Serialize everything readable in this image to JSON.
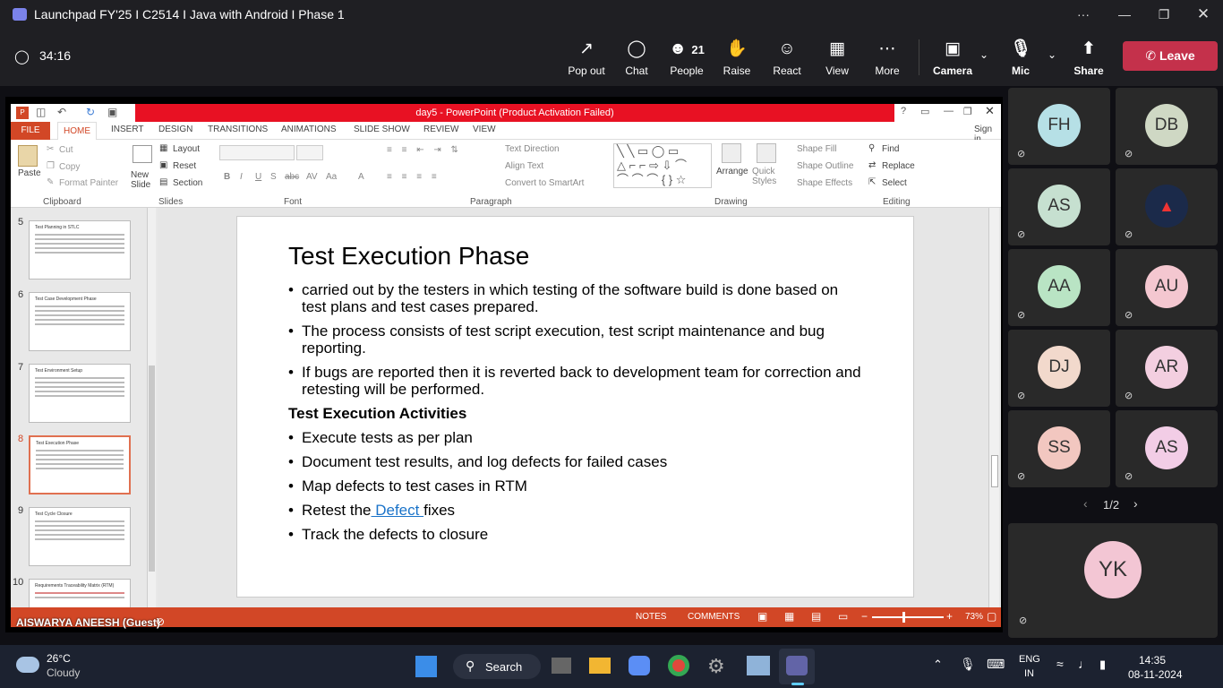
{
  "window": {
    "title": "Launchpad FY'25 I C2514 I Java with Android I Phase 1",
    "more": "···"
  },
  "meeting": {
    "timer": "34:16",
    "toolbar": [
      {
        "label": "Pop out"
      },
      {
        "label": "Chat"
      },
      {
        "label": "People",
        "count": "21"
      },
      {
        "label": "Raise"
      },
      {
        "label": "React"
      },
      {
        "label": "View"
      },
      {
        "label": "More"
      },
      {
        "label": "Camera"
      },
      {
        "label": "Mic"
      },
      {
        "label": "Share"
      }
    ],
    "leave": "Leave",
    "presenter": "AISWARYA ANEESH (Guest)"
  },
  "ppt": {
    "title": "day5 - PowerPoint (Product Activation Failed)",
    "help": "?",
    "signin": "Sign in",
    "tabs": [
      "FILE",
      "HOME",
      "INSERT",
      "DESIGN",
      "TRANSITIONS",
      "ANIMATIONS",
      "SLIDE SHOW",
      "REVIEW",
      "VIEW"
    ],
    "ribbon": {
      "clipboard": {
        "paste": "Paste",
        "cut": "Cut",
        "copy": "Copy",
        "format_painter": "Format Painter",
        "group": "Clipboard"
      },
      "slides": {
        "new_slide": "New Slide",
        "layout": "Layout",
        "reset": "Reset",
        "section": "Section",
        "group": "Slides"
      },
      "font": {
        "group": "Font",
        "bold": "B",
        "italic": "I",
        "underline": "U",
        "strike": "S",
        "abc": "abc",
        "spacing": "AV",
        "case": "Aa",
        "color": "A"
      },
      "paragraph": {
        "group": "Paragraph",
        "text_direction": "Text Direction",
        "align_text": "Align Text",
        "convert": "Convert to SmartArt"
      },
      "drawing": {
        "group": "Drawing",
        "arrange": "Arrange",
        "quick_styles": "Quick Styles",
        "shape_fill": "Shape Fill",
        "shape_outline": "Shape Outline",
        "shape_effects": "Shape Effects"
      },
      "editing": {
        "group": "Editing",
        "find": "Find",
        "replace": "Replace",
        "select": "Select"
      }
    },
    "thumbnails": [
      {
        "num": "5",
        "title": "Test Planning in STLC"
      },
      {
        "num": "6",
        "title": "Test Case Development Phase"
      },
      {
        "num": "7",
        "title": "Test Environment Setup"
      },
      {
        "num": "8",
        "title": "Test Execution Phase"
      },
      {
        "num": "9",
        "title": "Test Cycle Closure"
      },
      {
        "num": "10",
        "title": "Requirements Traceability Matrix (RTM)"
      }
    ],
    "slide": {
      "heading": "Test Execution Phase",
      "bullets": [
        "carried out by the testers in which testing of the software build is done based on test plans and test cases prepared.",
        "The process consists of test script execution, test script maintenance and bug reporting.",
        "If bugs are reported then it is reverted back to development team for correction and retesting will be performed."
      ],
      "subheading": "Test Execution Activities",
      "activities": [
        "Execute tests as per plan",
        "Document test results, and log defects for failed cases",
        "Map defects to test cases in RTM"
      ],
      "retest_pre": "Retest the",
      "retest_link": " Defect ",
      "retest_post": "fixes",
      "last": "Track the defects to closure"
    },
    "status": {
      "notes": "NOTES",
      "comments": "COMMENTS",
      "zoom": "73%"
    }
  },
  "participants": {
    "tiles": [
      {
        "initials": "FH",
        "color": "#b6e0e6"
      },
      {
        "initials": "DB",
        "color": "#cfd8c4"
      },
      {
        "initials": "AS",
        "color": "#c6e0d0"
      },
      {
        "initials": "",
        "color": "#1b2a4a"
      },
      {
        "initials": "AA",
        "color": "#b9e4c4"
      },
      {
        "initials": "AU",
        "color": "#f4c7d0"
      },
      {
        "initials": "DJ",
        "color": "#f2d9cc"
      },
      {
        "initials": "AR",
        "color": "#f3cfe0"
      },
      {
        "initials": "SS",
        "color": "#f2c7c0"
      },
      {
        "initials": "AS",
        "color": "#f2cde6"
      }
    ],
    "pager": "1/2",
    "self": {
      "initials": "YK",
      "color": "#f3c6d4"
    }
  },
  "taskbar": {
    "weather_temp": "26°C",
    "weather_desc": "Cloudy",
    "search": "Search",
    "lang1": "ENG",
    "lang2": "IN",
    "time": "14:35",
    "date": "08-11-2024"
  }
}
